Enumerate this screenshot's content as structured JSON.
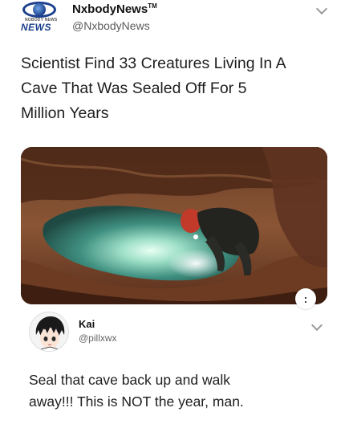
{
  "original_tweet": {
    "account_name": "NxbodyNews",
    "trademark": "TM",
    "handle": "@NxbodyNews",
    "logo_text": "NEWS",
    "logo_small_text": "NOBODY NEWS",
    "text_lines": [
      "Scientist Find 33 Creatures Living In A",
      "Cave That Was Sealed Off For 5",
      "Million Years"
    ],
    "media": {
      "image_description_icon": "cave-photo",
      "more_button": ":"
    }
  },
  "reply": {
    "account_name": "Kai",
    "handle": "@pillxwx",
    "text_lines": [
      "Seal that cave back up and walk",
      "away!!! This is NOT the year, man."
    ]
  },
  "colors": {
    "logo_blue": "#1b3f8c",
    "handle_gray": "#5b5b5b",
    "chevron_gray": "#9a9a9a"
  }
}
